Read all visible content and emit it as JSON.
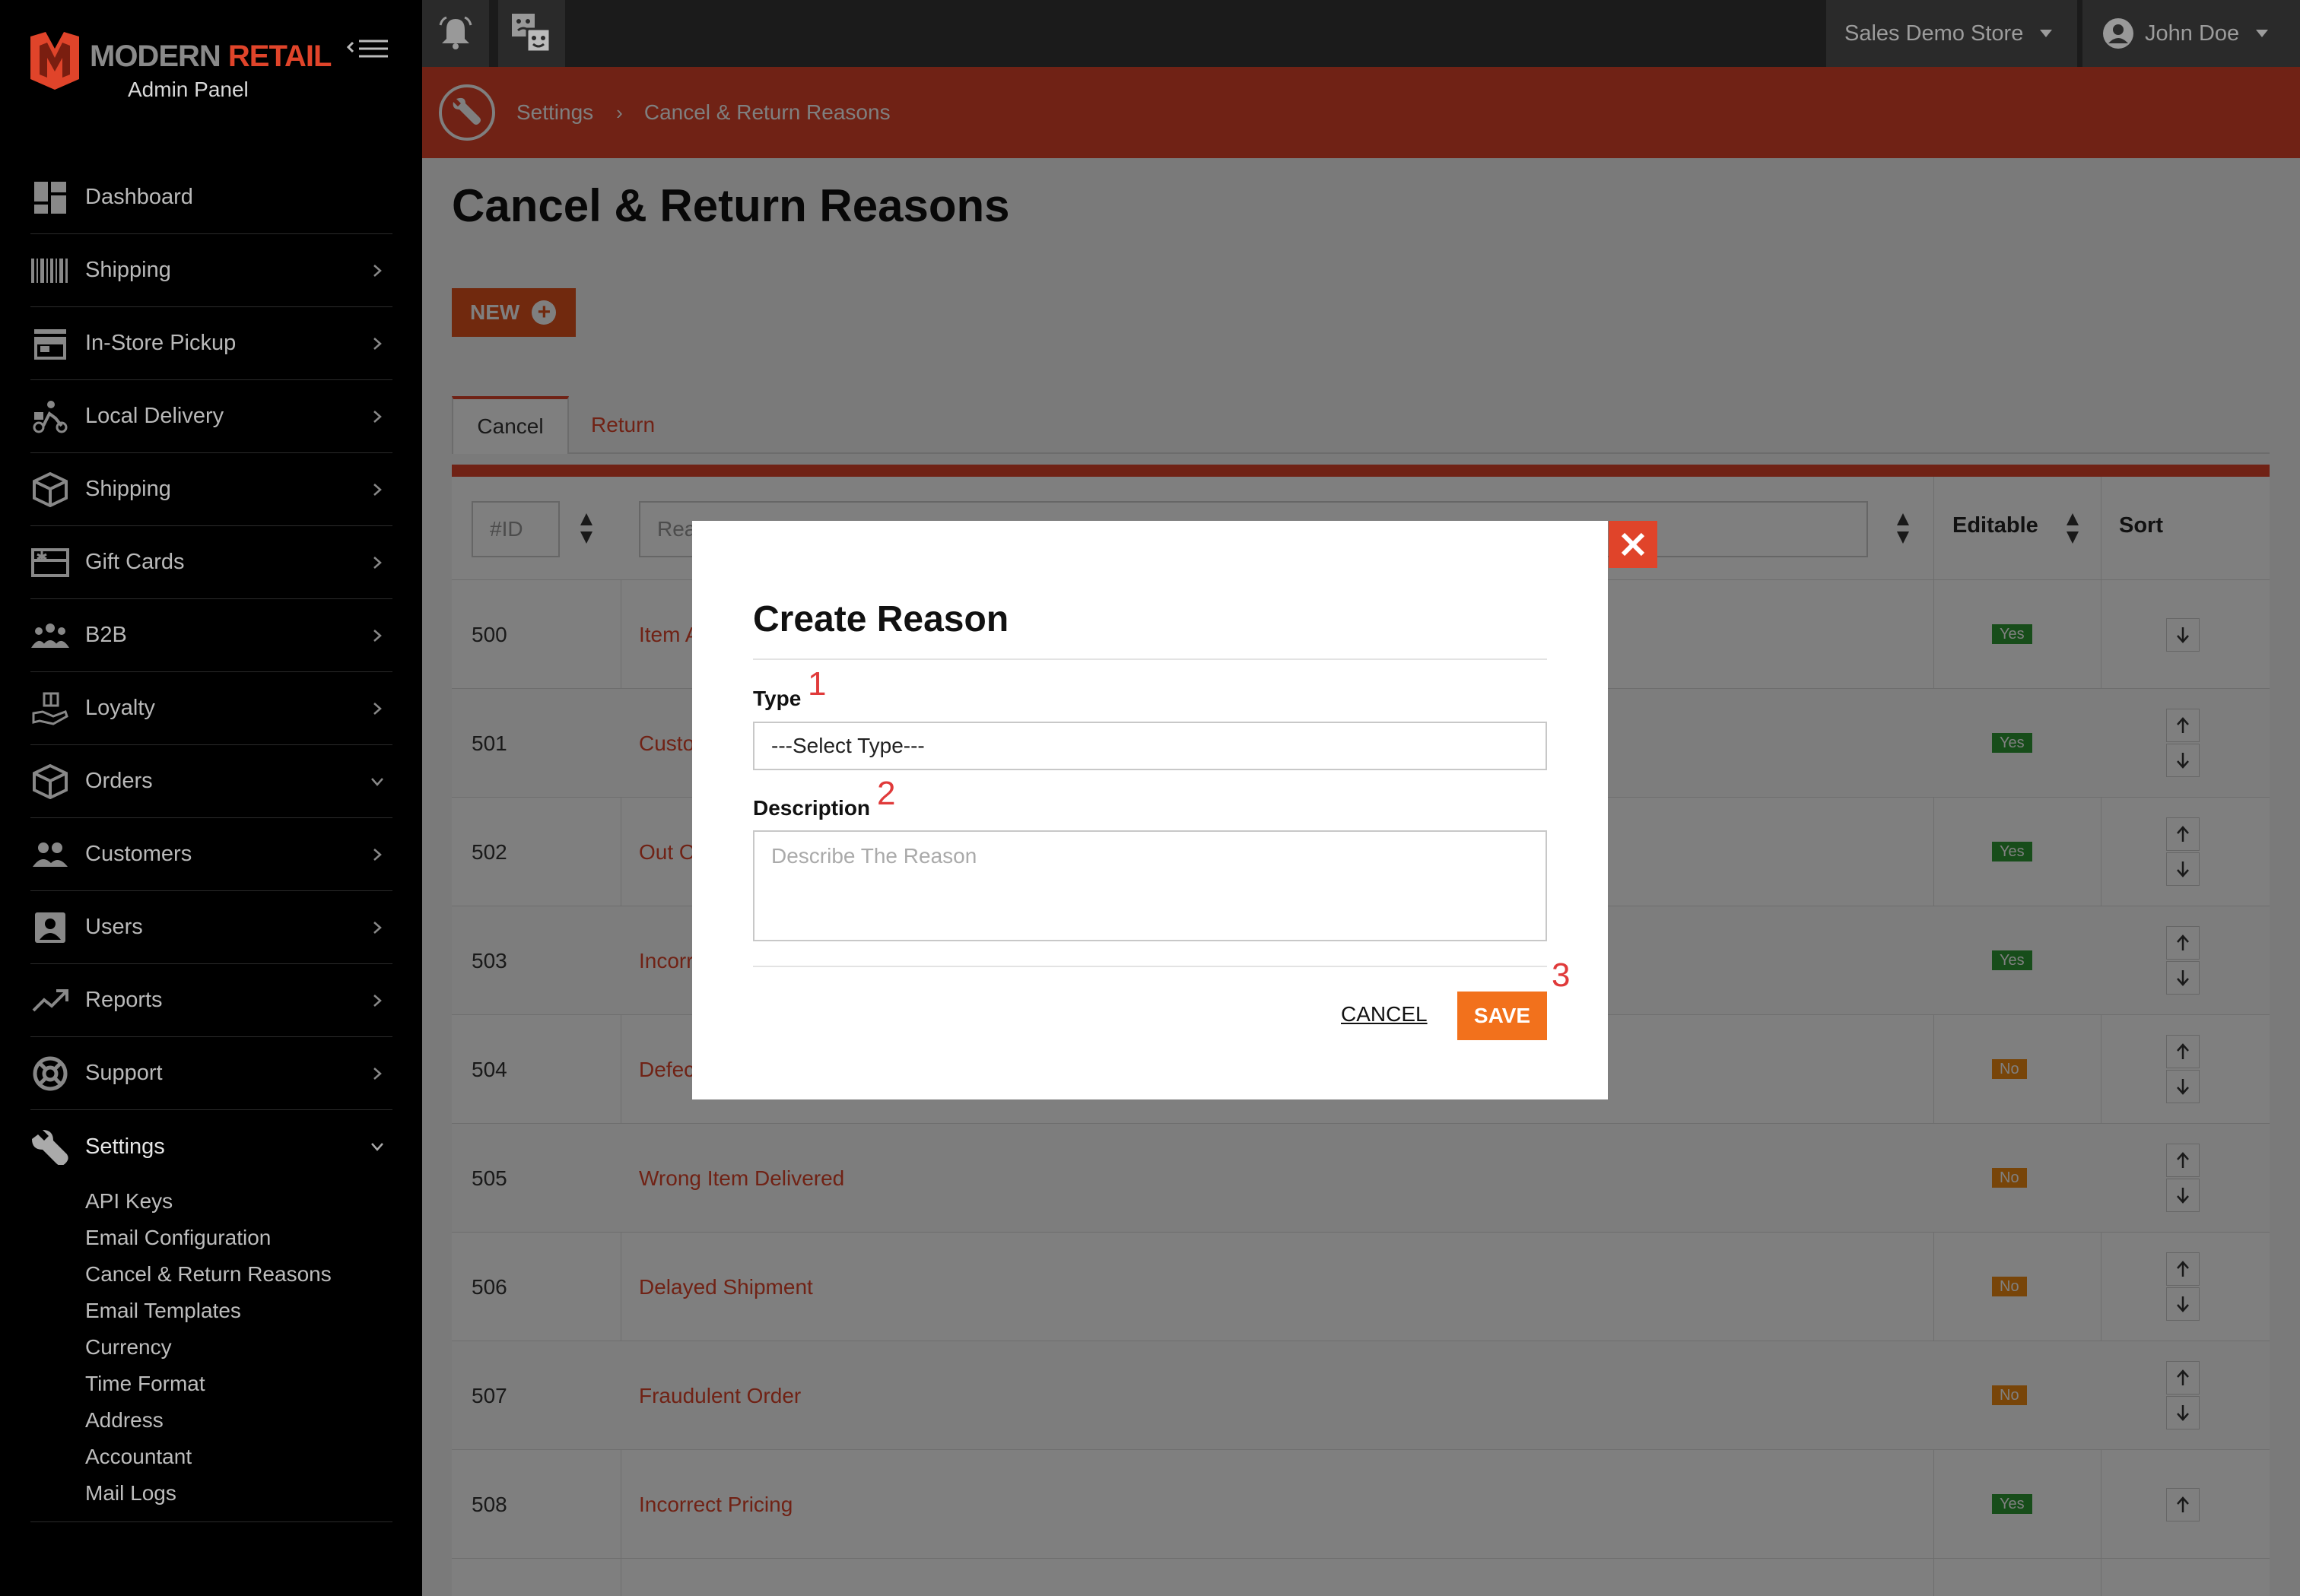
{
  "sidebar": {
    "logo_text_1": "MODERN",
    "logo_text_2": "RETAIL",
    "logo_sub": "Admin Panel",
    "items": [
      {
        "label": "Dashboard",
        "icon": "dashboard-icon"
      },
      {
        "label": "Shipping",
        "icon": "barcode-icon"
      },
      {
        "label": "In-Store Pickup",
        "icon": "store-icon"
      },
      {
        "label": "Local Delivery",
        "icon": "scooter-icon"
      },
      {
        "label": "Shipping",
        "icon": "box-icon"
      },
      {
        "label": "Gift Cards",
        "icon": "gift-card-icon"
      },
      {
        "label": "B2B",
        "icon": "group-icon"
      },
      {
        "label": "Loyalty",
        "icon": "loyalty-icon"
      },
      {
        "label": "Orders",
        "icon": "box-icon"
      },
      {
        "label": "Customers",
        "icon": "people-icon"
      },
      {
        "label": "Users",
        "icon": "user-badge-icon"
      },
      {
        "label": "Reports",
        "icon": "trend-icon"
      },
      {
        "label": "Support",
        "icon": "lifebuoy-icon"
      },
      {
        "label": "Settings",
        "icon": "wrench-icon"
      }
    ],
    "settings_sub": [
      "API Keys",
      "Email Configuration",
      "Cancel & Return Reasons",
      "Email Templates",
      "Currency",
      "Time Format",
      "Address",
      "Accountant",
      "Mail Logs"
    ]
  },
  "topbar": {
    "store": "Sales Demo Store",
    "user": "John Doe"
  },
  "breadcrumb": [
    "Settings",
    "Cancel & Return Reasons"
  ],
  "page": {
    "title": "Cancel & Return Reasons",
    "new_label": "NEW",
    "tabs": [
      "Cancel",
      "Return"
    ]
  },
  "table": {
    "filter_id_placeholder": "#ID",
    "filter_reason_placeholder": "Rea",
    "headers": {
      "editable": "Editable",
      "sort": "Sort"
    },
    "rows": [
      {
        "id": "500",
        "reason": "Item A",
        "editable": "Yes"
      },
      {
        "id": "501",
        "reason": "Custo",
        "editable": "Yes"
      },
      {
        "id": "502",
        "reason": "Out O",
        "editable": "Yes"
      },
      {
        "id": "503",
        "reason": "Incorr",
        "editable": "Yes"
      },
      {
        "id": "504",
        "reason": "Defec",
        "editable": "No"
      },
      {
        "id": "505",
        "reason": "Wrong Item Delivered",
        "editable": "No"
      },
      {
        "id": "506",
        "reason": "Delayed Shipment",
        "editable": "No"
      },
      {
        "id": "507",
        "reason": "Fraudulent Order",
        "editable": "No"
      },
      {
        "id": "508",
        "reason": "Incorrect Pricing",
        "editable": "Yes"
      }
    ]
  },
  "modal": {
    "title": "Create Reason",
    "type_label": "Type",
    "type_value": "---Select Type---",
    "description_label": "Description",
    "description_placeholder": "Describe The Reason",
    "cancel_label": "CANCEL",
    "save_label": "SAVE",
    "steps": [
      "1",
      "2",
      "3"
    ]
  },
  "colors": {
    "brand": "#e0442a",
    "save": "#f2711c",
    "yes": "#2f9a34",
    "no": "#f08a12"
  }
}
